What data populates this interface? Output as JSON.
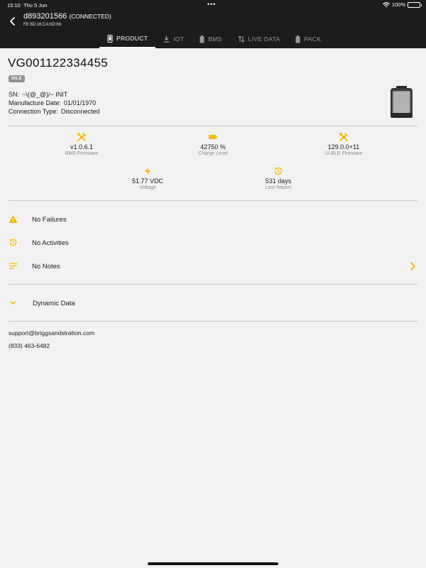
{
  "status_bar": {
    "time": "15:10",
    "date": "Thu 5 Jun",
    "battery": "100%",
    "icons": [
      "wifi-icon",
      "battery-icon"
    ]
  },
  "header": {
    "device_name": "d893201566",
    "connection_status": "(CONNECTED)",
    "mac": "FE:6D:16:CA:0D:69",
    "tabs": [
      {
        "label": "PRODUCT",
        "icon": "phone-icon",
        "active": true
      },
      {
        "label": "IOT",
        "icon": "download-icon",
        "active": false
      },
      {
        "label": "BMS",
        "icon": "battery-icon",
        "active": false
      },
      {
        "label": "LIVE DATA",
        "icon": "swap-arrows-icon",
        "active": false
      },
      {
        "label": "PACK",
        "icon": "battery-icon",
        "active": false
      }
    ]
  },
  "product": {
    "model": "VG001122334455",
    "state_badge": "IDLE",
    "sn_label": "SN:",
    "sn_value": "~\\(@_@)/~ INIT",
    "manufacture_label": "Manufacture Date:",
    "manufacture_value": "01/01/1970",
    "connection_label": "Connection Type:",
    "connection_value": "Disconnected"
  },
  "stats": [
    {
      "value": "v1.0.6.1",
      "label": "BMS Firmware",
      "icon": "tools-icon"
    },
    {
      "value": "42750 %",
      "label": "Charge Level",
      "icon": "battery-icon"
    },
    {
      "value": "129.0.0+11",
      "label": "UI BLE Firmware",
      "icon": "tools-icon"
    },
    {
      "value": "51.77 VDC",
      "label": "Voltage",
      "icon": "lightning-icon"
    },
    {
      "value": "531 days",
      "label": "Last Report",
      "icon": "history-icon"
    }
  ],
  "list": {
    "failures": "No Failures",
    "activities": "No Activities",
    "notes": "No Notes",
    "dynamic_data": "Dynamic Data"
  },
  "contact": {
    "email": "support@briggsandstratton.com",
    "phone": "(833) 463-6482"
  },
  "colors": {
    "accent": "#f5b800",
    "header_bg": "#1c1c1c",
    "page_bg": "#f2f2f2"
  }
}
